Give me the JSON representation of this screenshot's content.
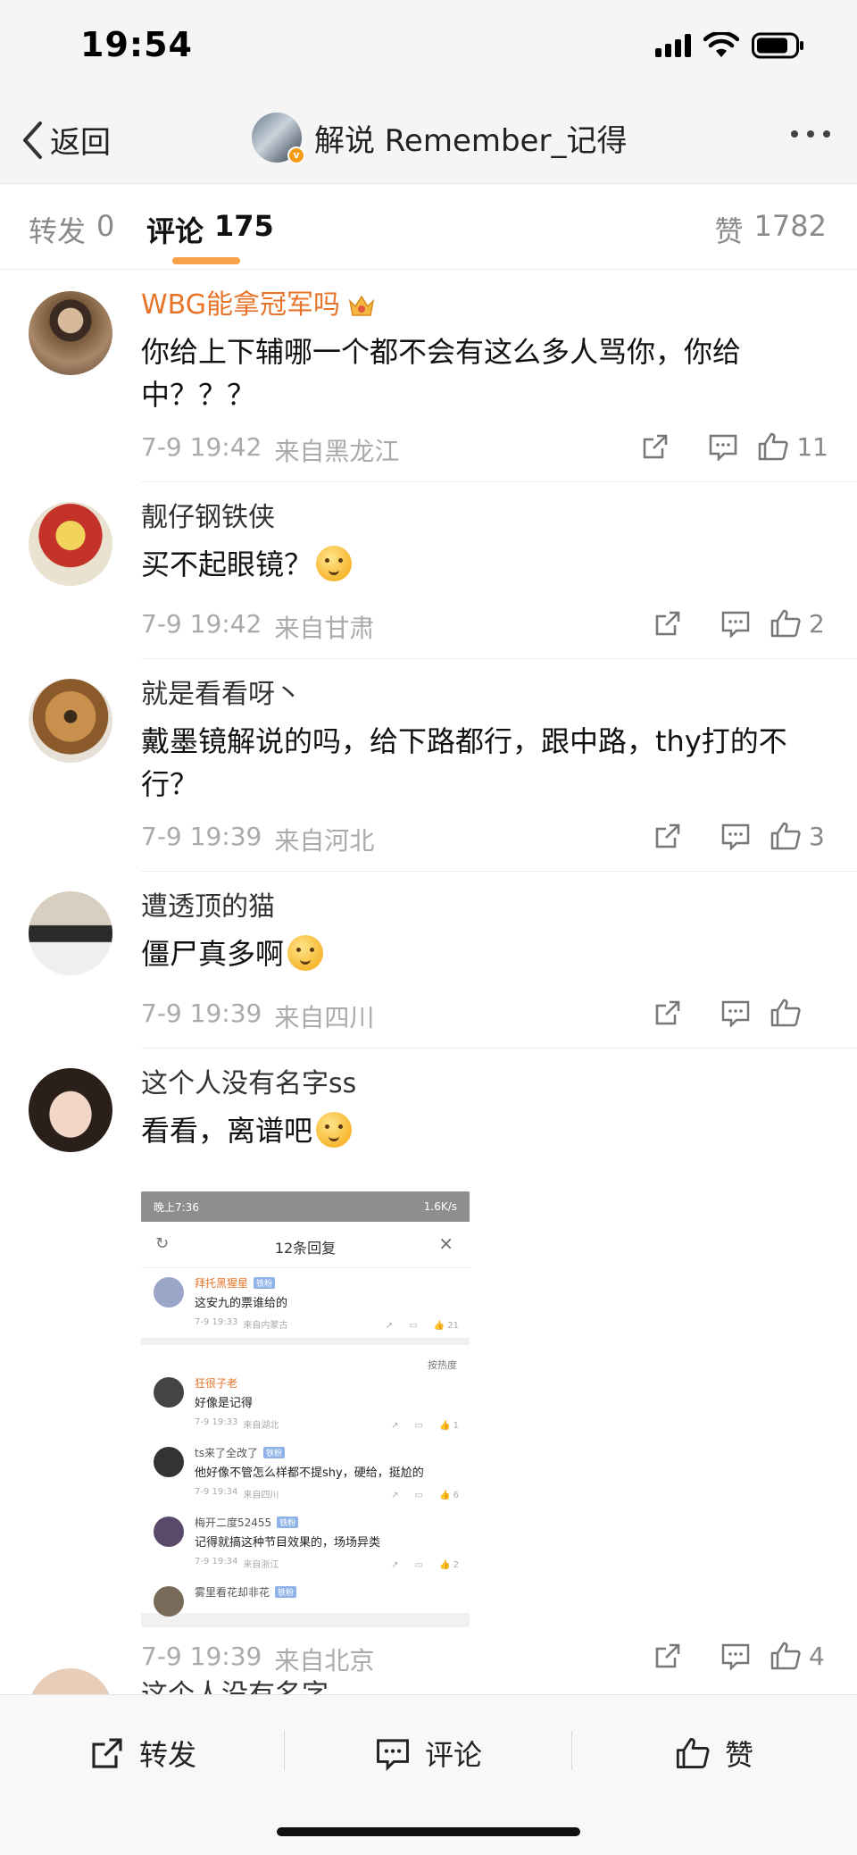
{
  "status": {
    "time": "19:54"
  },
  "nav": {
    "back_label": "返回",
    "title": "解说 Remember_记得",
    "verified_badge": "v"
  },
  "tabs": {
    "reposts_label": "转发",
    "reposts_count": "0",
    "comments_label": "评论",
    "comments_count": "175",
    "likes_label": "赞",
    "likes_count": "1782"
  },
  "comments": [
    {
      "name": "WBG能拿冠军吗",
      "vip": true,
      "text": "你给上下辅哪一个都不会有这么多人骂你，你给中？？？",
      "time": "7-9 19:42",
      "location": "来自黑龙江",
      "likes": "11"
    },
    {
      "name": "靓仔钢铁侠",
      "text": "买不起眼镜？",
      "time": "7-9 19:42",
      "location": "来自甘肃",
      "likes": "2"
    },
    {
      "name": "就是看看呀丶",
      "text": "戴墨镜解说的吗，给下路都行，跟中路，thy打的不行？",
      "time": "7-9 19:39",
      "location": "来自河北",
      "likes": "3"
    },
    {
      "name": "遭透顶的猫",
      "text": "僵尸真多啊",
      "time": "7-9 19:39",
      "location": "来自四川",
      "likes": ""
    },
    {
      "name": "这个人没有名字ss",
      "text": "看看，离谱吧",
      "time": "7-9 19:39",
      "location": "来自北京",
      "likes": "4"
    }
  ],
  "embed": {
    "status_time": "晚上7:36",
    "status_right": "1.6K/s",
    "title": "12条回复",
    "sort_label": "按热度",
    "top": {
      "name": "拜托黑猩星",
      "text": "这安九的票谁给的",
      "time": "7-9 19:33",
      "location": "来自内蒙古",
      "likes": "21"
    },
    "replies": [
      {
        "name": "狂很子老",
        "text": "好像是记得",
        "time": "7-9 19:33",
        "location": "来自湖北",
        "likes": "1"
      },
      {
        "name": "ts来了全改了",
        "text": "他好像不管怎么样都不提shy，硬给，挺尬的",
        "time": "7-9 19:34",
        "location": "来自四川",
        "likes": "6"
      },
      {
        "name": "梅开二度52455",
        "text": "记得就搞这种节目效果的，场场异类",
        "time": "7-9 19:34",
        "location": "来自浙江",
        "likes": "2"
      },
      {
        "name": "雾里看花却非花",
        "text": "",
        "time": "",
        "location": "",
        "likes": ""
      }
    ]
  },
  "partial_next_name": "这个人没有名字",
  "bottom": {
    "repost_label": "转发",
    "comment_label": "评论",
    "like_label": "赞"
  },
  "colors": {
    "accent": "#f7a248",
    "vip_name": "#e8742a",
    "meta_gray": "#aaaaaa"
  }
}
